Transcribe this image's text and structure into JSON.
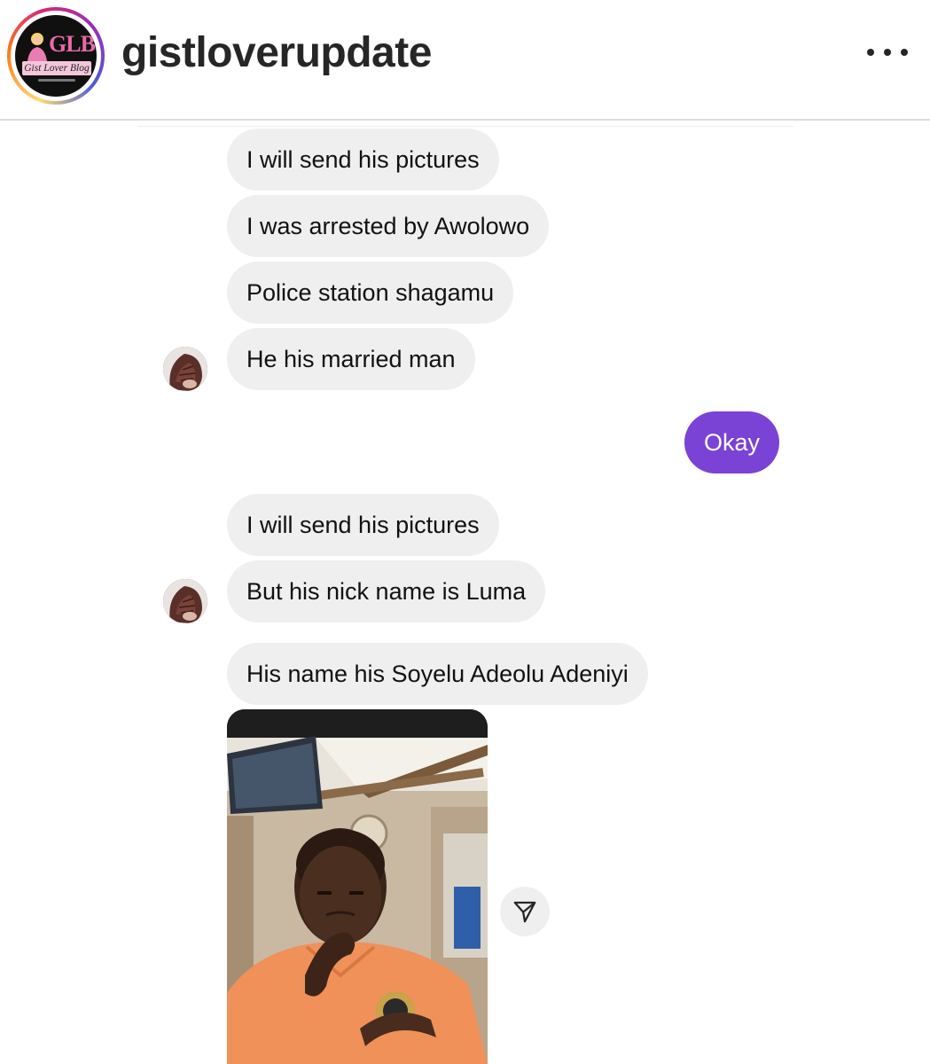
{
  "header": {
    "username": "gistloverupdate",
    "avatar_logo_text": "GLB",
    "avatar_subtext": "Gist Lover Blog",
    "more_icon": "more-horizontal-icon"
  },
  "messages": [
    {
      "direction": "incoming",
      "text": "I will send his pictures"
    },
    {
      "direction": "incoming",
      "text": "I was arrested by Awolowo"
    },
    {
      "direction": "incoming",
      "text": "Police station shagamu"
    },
    {
      "direction": "incoming",
      "text": "He his  married man"
    },
    {
      "direction": "outgoing",
      "text": "Okay"
    },
    {
      "direction": "incoming",
      "text": "I will send his pictures"
    },
    {
      "direction": "incoming",
      "text": "But his nick name is Luma"
    },
    {
      "direction": "incoming",
      "text": "His name his Soyelu Adeolu Adeniyi"
    }
  ],
  "photo_message": {
    "type": "image",
    "share_icon": "send-icon"
  },
  "colors": {
    "incoming_bubble": "#efefef",
    "outgoing_bubble": "#7b42d6",
    "header_text": "#262626"
  }
}
